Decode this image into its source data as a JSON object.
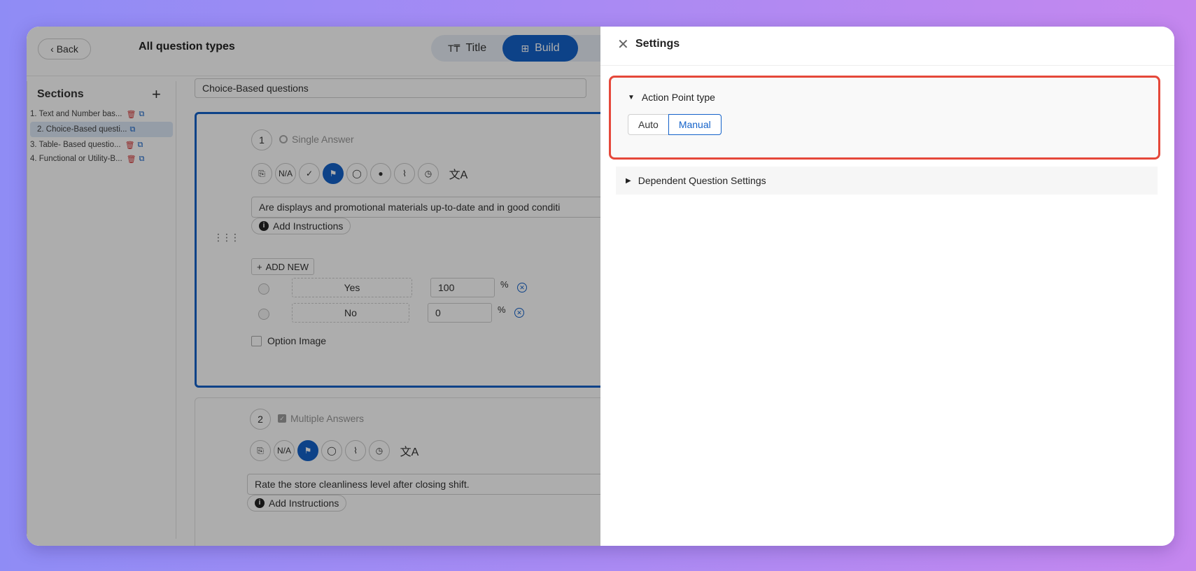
{
  "builder": {
    "back_label": "‹ Back",
    "page_title": "All question types",
    "mode_tabs": [
      {
        "label": "Title",
        "icon": "T₸"
      },
      {
        "label": "Build",
        "icon": "⊞"
      }
    ],
    "sections": {
      "header": "Sections",
      "add_icon": "+",
      "items": [
        {
          "label": "1. Text and Number bas..."
        },
        {
          "label": "2. Choice-Based questi..."
        },
        {
          "label": "3. Table- Based questio..."
        },
        {
          "label": "4. Functional or Utility-B..."
        }
      ]
    },
    "section_name": "Choice-Based questions",
    "questions": [
      {
        "number": "1",
        "type": "Single Answer",
        "tools": [
          "⎘",
          "N/A",
          "✓",
          "⚑",
          "◯",
          "●",
          "⌇",
          "◷",
          "文A"
        ],
        "text": "Are displays and promotional materials up-to-date and in good conditi",
        "instructions": "Add Instructions",
        "add_new": "ADD NEW",
        "options": [
          {
            "label": "Yes",
            "score": "100",
            "unit": "%"
          },
          {
            "label": "No",
            "score": "0",
            "unit": "%"
          }
        ],
        "option_image": "Option Image"
      },
      {
        "number": "2",
        "type": "Multiple Answers",
        "tools": [
          "⎘",
          "N/A",
          "⚑",
          "◯",
          "⌇",
          "◷",
          "文A"
        ],
        "text": "Rate the store cleanliness level after closing shift.",
        "instructions": "Add Instructions"
      }
    ]
  },
  "settings": {
    "title": "Settings",
    "close_icon": "✕",
    "action_point": {
      "heading": "Action Point type",
      "options": [
        "Auto",
        "Manual"
      ],
      "selected": "Manual"
    },
    "dependent": {
      "heading": "Dependent Question Settings"
    }
  },
  "colors": {
    "accent": "#1462c9",
    "highlight": "#e5483a"
  }
}
